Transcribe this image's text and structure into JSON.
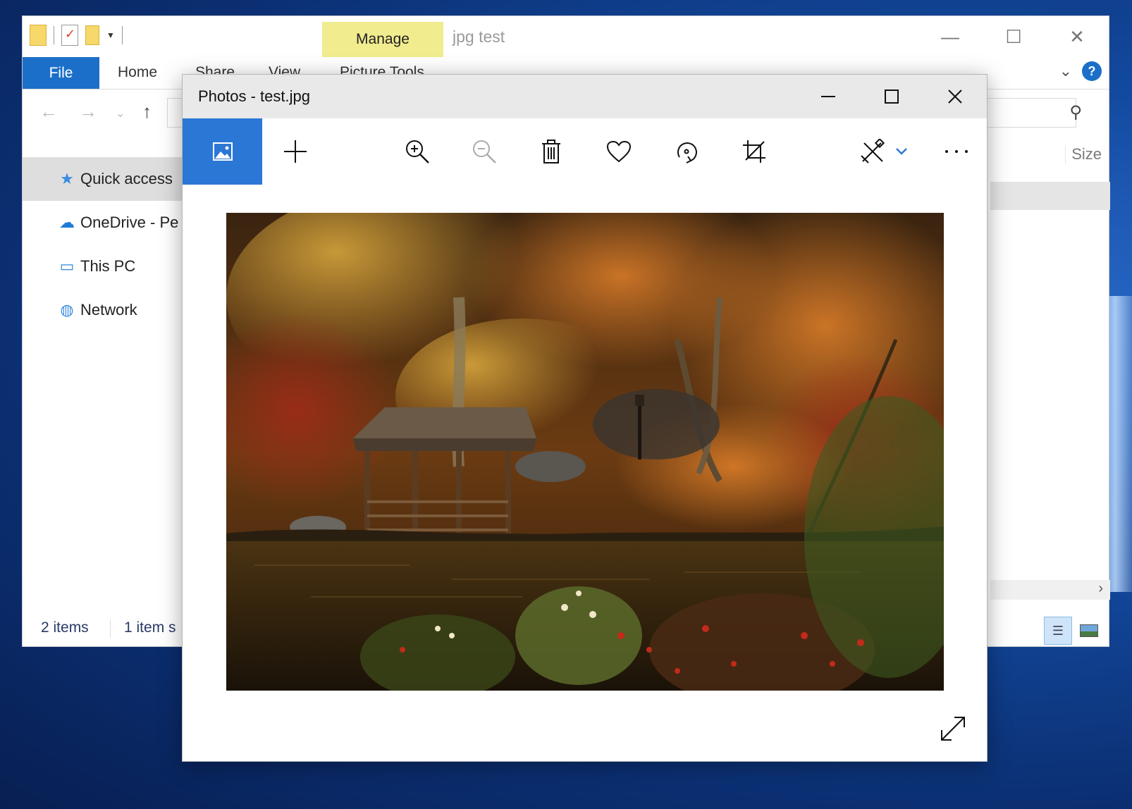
{
  "explorer": {
    "title": "jpg test",
    "context_tab": "Manage",
    "tabs": {
      "file": "File",
      "home": "Home",
      "share": "Share",
      "view": "View",
      "picture_tools": "Picture Tools"
    },
    "column_header": "Size",
    "sidebar": [
      {
        "label": "Quick access",
        "icon": "star-icon"
      },
      {
        "label": "OneDrive - Pe",
        "icon": "cloud-icon"
      },
      {
        "label": "This PC",
        "icon": "computer-icon"
      },
      {
        "label": "Network",
        "icon": "network-icon"
      }
    ],
    "status": {
      "count": "2 items",
      "selected": "1 item s"
    }
  },
  "photos": {
    "title": "Photos - test.jpg",
    "toolbar": [
      "see-all-photos",
      "add-to",
      "zoom-in",
      "zoom-out",
      "delete",
      "favorite",
      "rotate",
      "crop",
      "edit-create",
      "more"
    ],
    "image_alt": "Autumn forest with a wooden gazebo by a pond"
  },
  "colors": {
    "accent": "#2b77d6",
    "manage_tab": "#f1ec8e",
    "file_tab": "#1c6fc8"
  }
}
